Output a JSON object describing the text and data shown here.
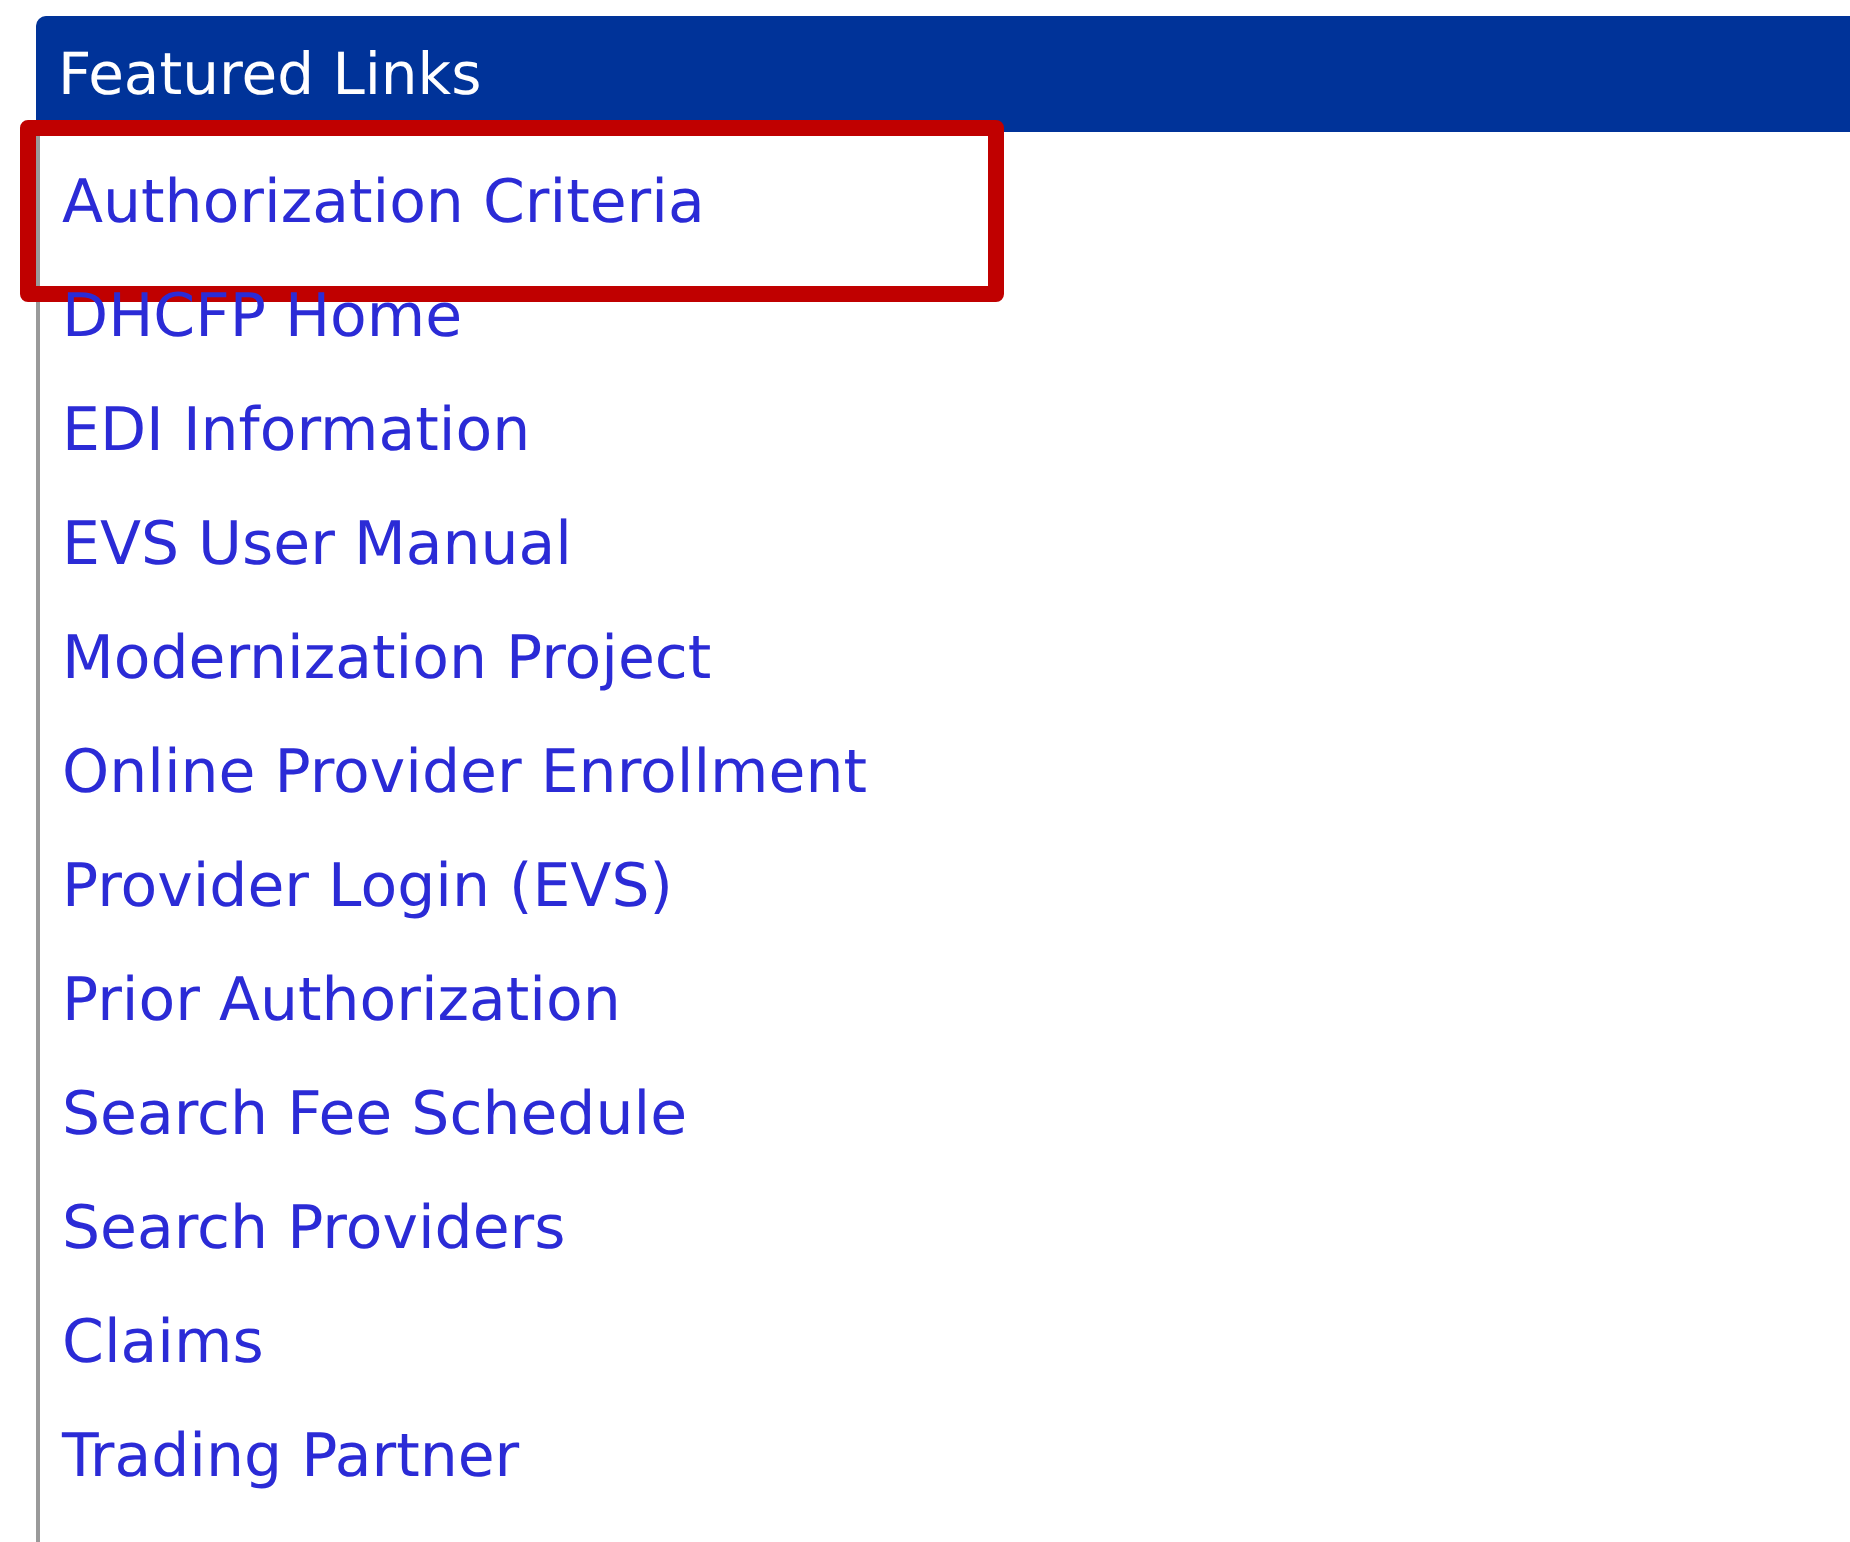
{
  "panel": {
    "title": "Featured Links",
    "links": [
      {
        "label": "Authorization Criteria",
        "highlighted": true
      },
      {
        "label": "DHCFP Home",
        "highlighted": false
      },
      {
        "label": "EDI Information",
        "highlighted": false
      },
      {
        "label": "EVS User Manual",
        "highlighted": false
      },
      {
        "label": "Modernization Project",
        "highlighted": false
      },
      {
        "label": "Online Provider Enrollment",
        "highlighted": false
      },
      {
        "label": "Provider Login (EVS)",
        "highlighted": false
      },
      {
        "label": "Prior Authorization",
        "highlighted": false
      },
      {
        "label": "Search Fee Schedule",
        "highlighted": false
      },
      {
        "label": "Search Providers",
        "highlighted": false
      },
      {
        "label": "Claims",
        "highlighted": false
      },
      {
        "label": "Trading Partner",
        "highlighted": false
      }
    ]
  }
}
